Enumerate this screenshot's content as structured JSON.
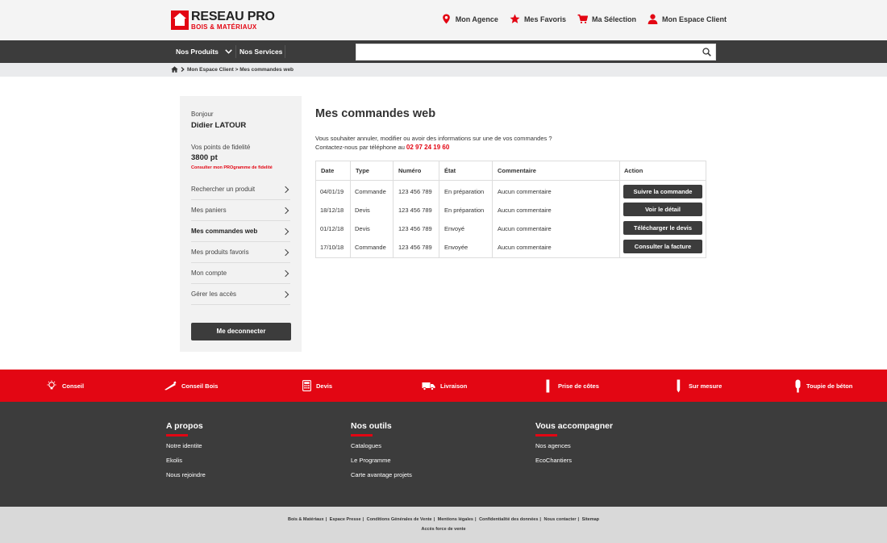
{
  "brand": {
    "name_line1": "RESEAU PRO",
    "name_line2": "BOIS & MATÉRIAUX",
    "accent": "#e30613",
    "dark": "#3c3c3c"
  },
  "topnav": [
    {
      "label": "Mon Agence",
      "icon": "location-pin-icon"
    },
    {
      "label": "Mes Favoris",
      "icon": "star-icon"
    },
    {
      "label": "Ma Sélection",
      "icon": "cart-icon"
    },
    {
      "label": "Mon Espace Client",
      "icon": "user-icon"
    }
  ],
  "navbar": {
    "products": "Nos Produits",
    "services": "Nos Services",
    "search_placeholder": ""
  },
  "breadcrumb": {
    "path": "Mon Espace Client > Mes commandes web"
  },
  "sidebar": {
    "greeting": "Bonjour",
    "user": "Didier LATOUR",
    "points_label": "Vos points de fidelité",
    "points": "3800 pt",
    "program_link": "Consulter mon PROgramme de fidelité",
    "items": [
      {
        "label": "Rechercher un produit"
      },
      {
        "label": "Mes paniers"
      },
      {
        "label": "Mes commandes web"
      },
      {
        "label": "Mes produits favoris"
      },
      {
        "label": "Mon compte"
      },
      {
        "label": "Gérer les accès"
      }
    ],
    "logout": "Me deconnecter"
  },
  "main": {
    "title": "Mes commandes web",
    "intro": "Vous souhaiter annuler, modifier ou avoir des informations sur une de vos commandes ?",
    "contact": "Contactez-nous par téléphone au",
    "phone": "02 97 24 19 60",
    "table": {
      "headers": [
        "Date",
        "Type",
        "Numéro",
        "État",
        "Commentaire",
        "Action"
      ],
      "rows": [
        {
          "date": "04/01/19",
          "type": "Commande",
          "num": "123 456 789",
          "state": "En préparation",
          "comment": "Aucun commentaire",
          "action": "Suivre la commande"
        },
        {
          "date": "18/12/18",
          "type": "Devis",
          "num": "123 456 789",
          "state": "En préparation",
          "comment": "Aucun commentaire",
          "action": "Voir le détail"
        },
        {
          "date": "01/12/18",
          "type": "Devis",
          "num": "123 456 789",
          "state": "Envoyé",
          "comment": "Aucun commentaire",
          "action": "Télécharger le devis"
        },
        {
          "date": "17/10/18",
          "type": "Commande",
          "num": "123 456 789",
          "state": "Envoyée",
          "comment": "Aucun commentaire",
          "action": "Consulter la facture"
        }
      ]
    }
  },
  "services": [
    {
      "label": "Conseil",
      "icon": "lightbulb-icon"
    },
    {
      "label": "Conseil Bois",
      "icon": "saw-icon"
    },
    {
      "label": "Devis",
      "icon": "calculator-icon"
    },
    {
      "label": "Livraison",
      "icon": "truck-icon"
    },
    {
      "label": "Prise de côtes",
      "icon": "ruler-icon"
    },
    {
      "label": "Sur mesure",
      "icon": "pencil-icon"
    },
    {
      "label": "Toupie de béton",
      "icon": "concrete-mixer-icon"
    }
  ],
  "footer": {
    "cols": [
      {
        "title": "A propos",
        "links": [
          "Notre identite",
          "Ekolis",
          "Nous rejoindre"
        ]
      },
      {
        "title": "Nos outils",
        "links": [
          "Catalogues",
          "Le Programme",
          "Carte avantage projets"
        ]
      },
      {
        "title": "Vous accompagner",
        "links": [
          "Nos agences",
          "EcoChantiers"
        ]
      }
    ],
    "legal": [
      "Bois & Matériaux",
      "Espace Presse",
      "Conditions Générales de Vente",
      "Mentions légales",
      "Confidentialité des données",
      "Nous contacter",
      "Sitemap"
    ],
    "legal2": "Accès force de vente"
  }
}
